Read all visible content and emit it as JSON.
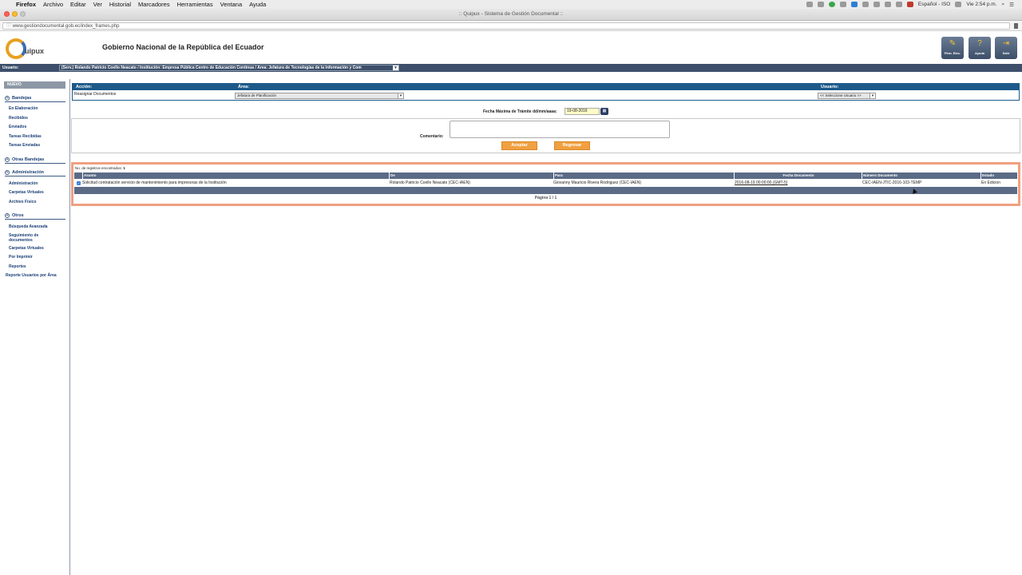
{
  "menubar": {
    "app": "Firefox",
    "items": [
      "Archivo",
      "Editar",
      "Ver",
      "Historial",
      "Marcadores",
      "Herramientas",
      "Ventana",
      "Ayuda"
    ],
    "input_source": "Español - ISO",
    "clock": "Vie 2:54 p.m."
  },
  "window": {
    "title": ":: Quipux - Sistema de Gestión Documental ::"
  },
  "urlbar": {
    "url": "www.gestiondocumental.gob.ec/index_frames.php"
  },
  "header": {
    "logo_text": "uipux",
    "title": "Gobierno Nacional de la República del Ecuador",
    "buttons": [
      {
        "label": "Firm. Elec.",
        "icon": "pen-icon"
      },
      {
        "label": "Ayuda",
        "icon": "help-icon"
      },
      {
        "label": "Salir",
        "icon": "exit-icon"
      }
    ]
  },
  "userstrip": {
    "label": "Usuario:",
    "value": "(Serv.) Rolando Patricio Coello Neacato / Institución: Empresa Pública Centro de Educación Continua / Área: Jefatura de Tecnologías de la Información y Com"
  },
  "sidebar": {
    "nuevo": "NUEVO",
    "sections": [
      {
        "title": "Bandejas",
        "items": [
          "En Elaboración",
          "Recibidos",
          "Enviados",
          "Tareas Recibidas",
          "Tareas Enviadas"
        ]
      },
      {
        "title": "Otras Bandejas",
        "items": []
      },
      {
        "title": "Administración",
        "items": [
          "Administración",
          "Carpetas Virtuales",
          "Archivo Físico"
        ]
      },
      {
        "title": "Otros",
        "items": [
          "Búsqueda Avanzada",
          "Seguimiento de documentos",
          "Carpetas Virtuales",
          "Por Imprimir",
          "Reportes",
          "Reporte Usuarios por Área"
        ]
      }
    ]
  },
  "action_panel": {
    "accion_label": "Acción:",
    "accion_value": "Reasignar Documentos",
    "area_label": "Área:",
    "area_value": "Jefatura de Planificación",
    "usuario_label": "Usuario:",
    "usuario_value": "<< Seleccione Usuario >>"
  },
  "fecha": {
    "label": "Fecha Máxima de Trámite dd/mm/aaaa:",
    "value": "19-08-2016"
  },
  "comentario": {
    "label": "Comentario:",
    "value": ""
  },
  "buttons": {
    "aceptar": "Aceptar",
    "regresar": "Regresar"
  },
  "results": {
    "count_label": "No. de registros encontrados:",
    "count_value": "1",
    "columns": [
      "Asunto",
      "De",
      "Para",
      "Fecha Documento",
      "Número Documento",
      "Estado"
    ],
    "rows": [
      {
        "asunto": "Solicitud contratación servicio de mantenimiento para impresoras de la Institución",
        "de": "Rolando Patricio Coello Neacato (CEC-IAEN)",
        "para": "Giovanny Mauricio Rivera Rodriguez (CEC-IAEN)",
        "fecha": "2016-08-19 00:00:00 (GMT-5)",
        "numero": "CEC-IAEN-JTIC-2016-103-TEMP",
        "estado": "En Edicion"
      }
    ],
    "pager": "Página 1 / 1"
  },
  "colors": {
    "navy": "#3d4f6a",
    "blue": "#1d5a8a",
    "orange": "#f0a040",
    "results_border": "#f0a080"
  }
}
